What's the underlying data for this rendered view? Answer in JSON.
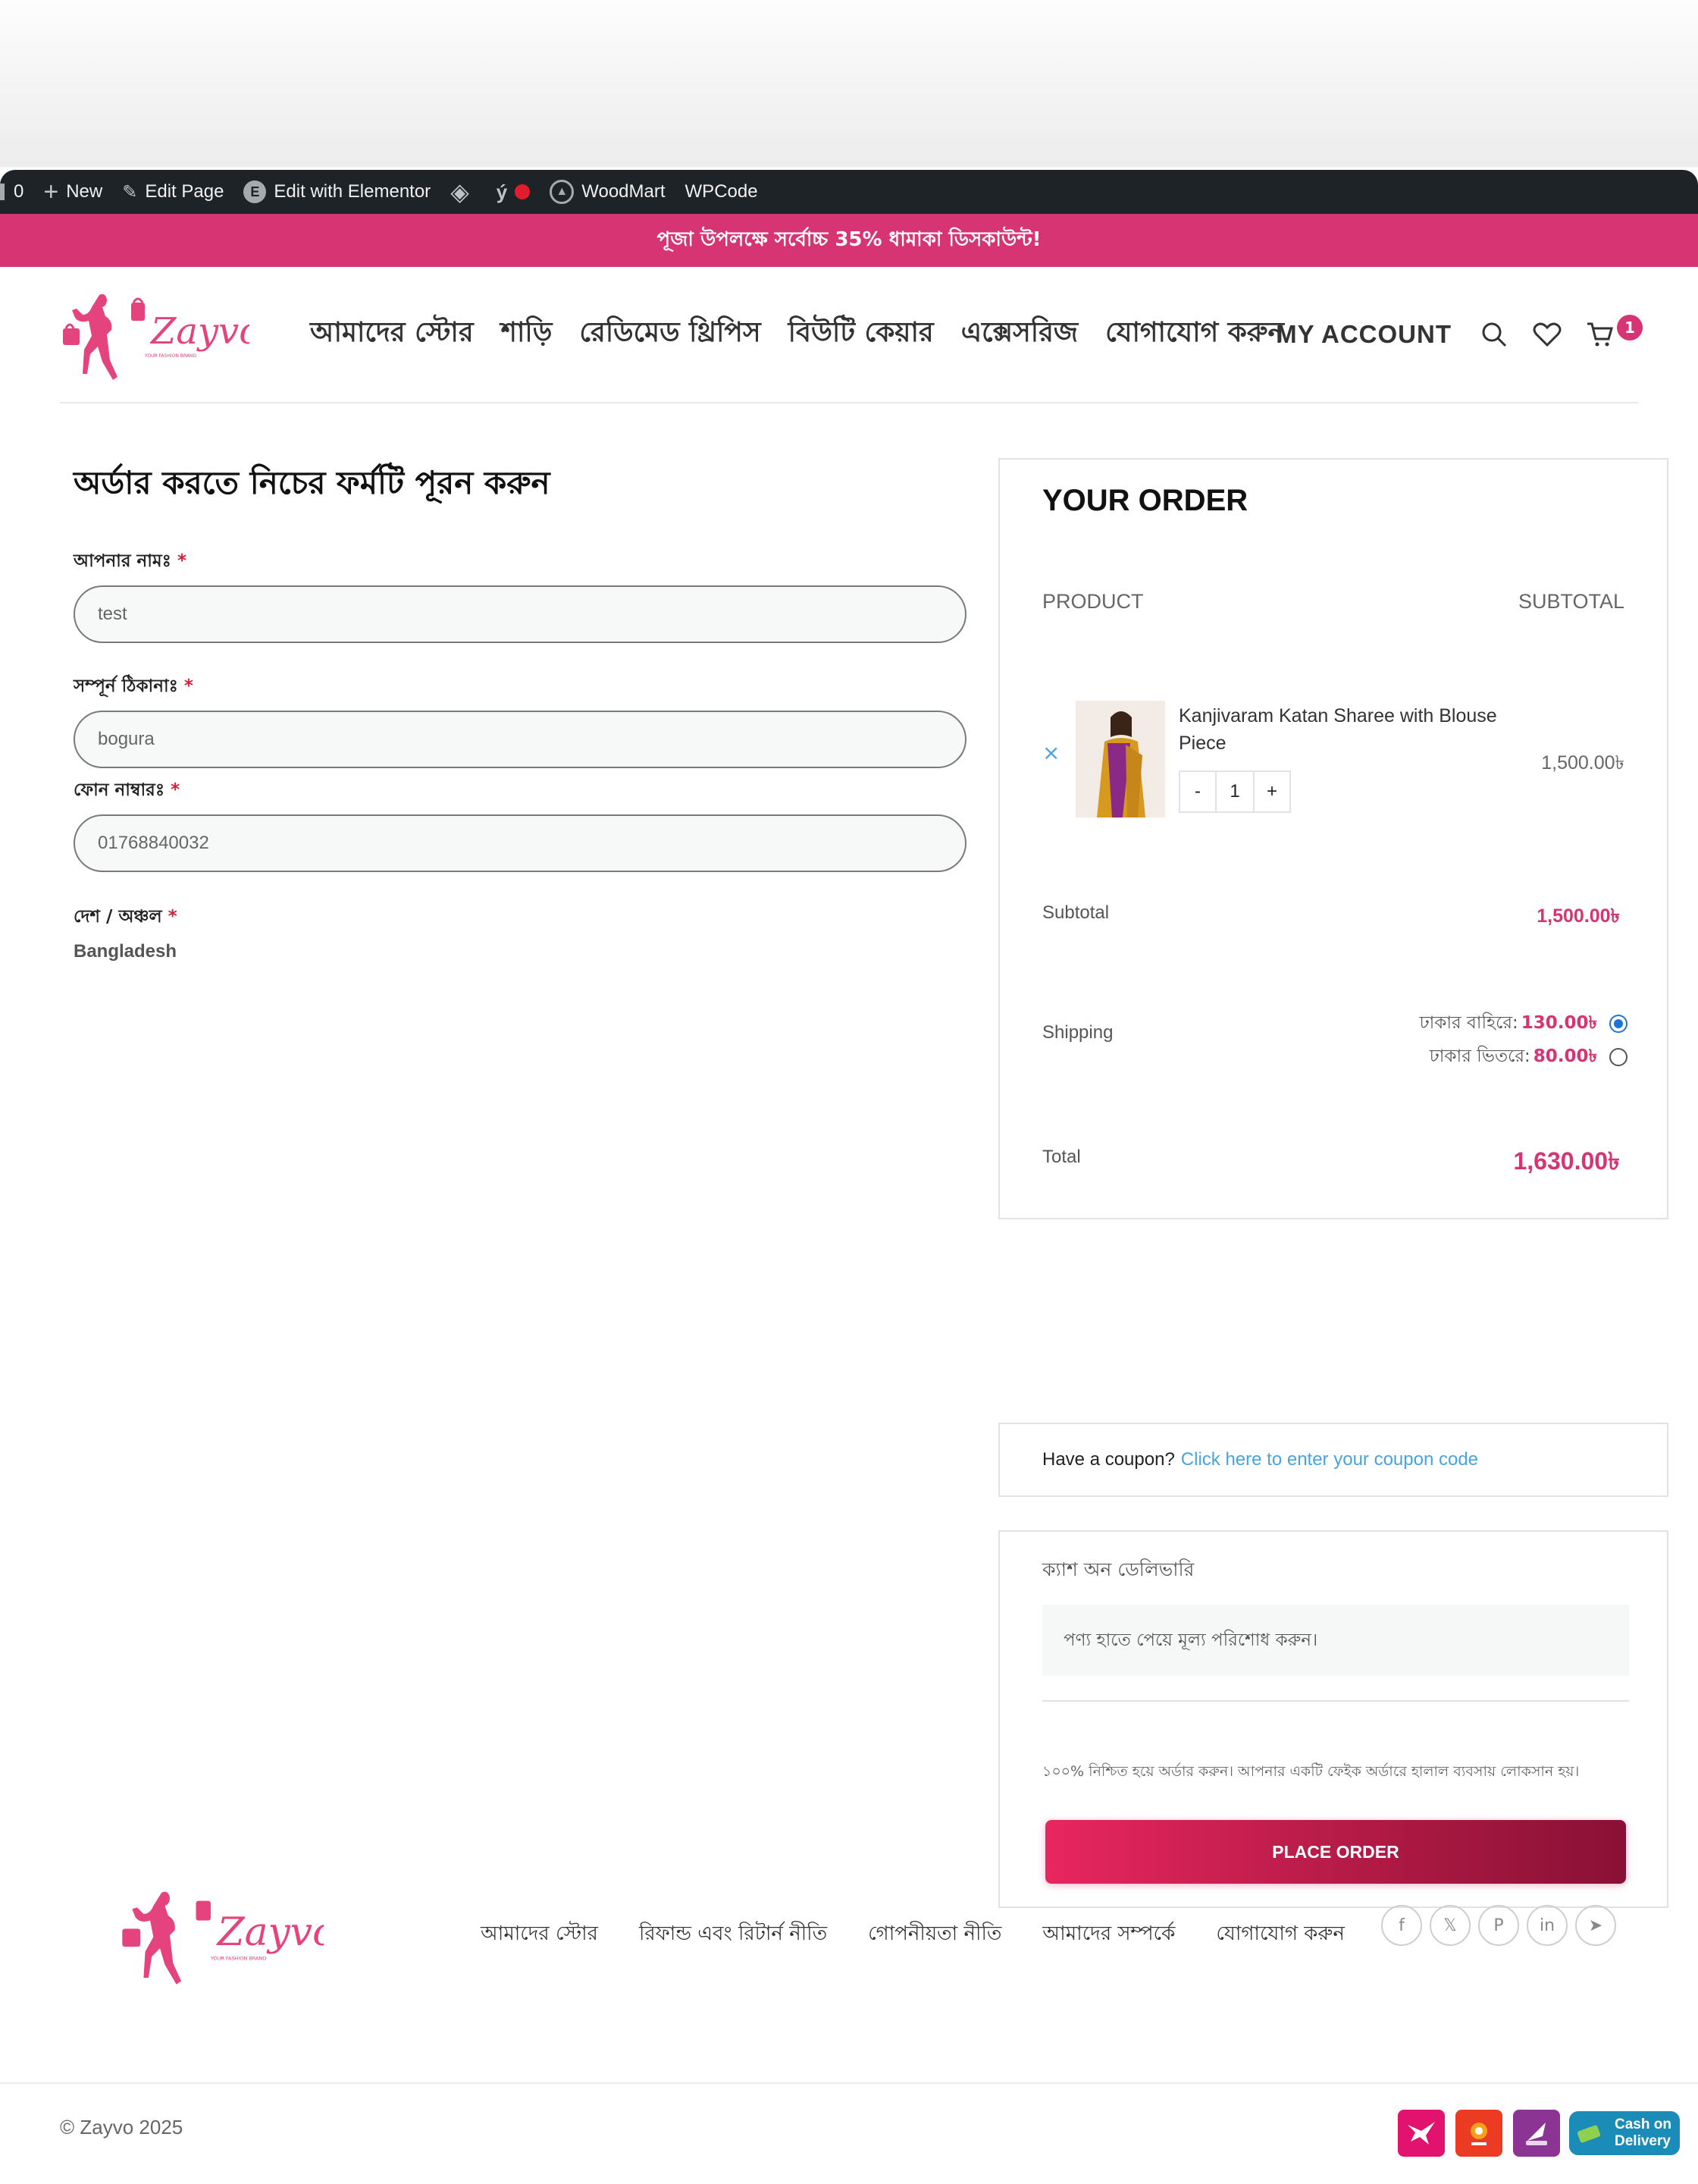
{
  "admin_bar": {
    "count": "0",
    "new_label": "New",
    "edit_page_label": "Edit Page",
    "elementor_label": "Edit with Elementor",
    "woodmart_label": "WoodMart",
    "wpcode_label": "WPCode"
  },
  "promo": {
    "text": "পূজা উপলক্ষে সর্বোচ্চ 35% ধামাকা ডিসকাউন্ট!"
  },
  "header": {
    "logo_text": "Zayvo",
    "logo_tagline": "YOUR FASHION BRAND",
    "nav": [
      "আমাদের স্টোর",
      "শাড়ি",
      "রেডিমেড থ্রিপিস",
      "বিউটি কেয়ার",
      "এক্সেসরিজ",
      "যোগাযোগ করুন"
    ],
    "account_label": "MY ACCOUNT",
    "cart_count": "1"
  },
  "form": {
    "title": "অর্ডার করতে নিচের ফর্মটি পূরন করুন",
    "name_label": "আপনার নামঃ",
    "name_value": "test",
    "address_label": "সম্পূর্ন ঠিকানাঃ",
    "address_value": "bogura",
    "phone_label": "ফোন নাম্বারঃ",
    "phone_value": "01768840032",
    "country_label": "দেশ / অঞ্চল",
    "country_value": "Bangladesh",
    "required_mark": "*"
  },
  "order": {
    "title": "YOUR ORDER",
    "col_product": "PRODUCT",
    "col_subtotal": "SUBTOTAL",
    "remove_symbol": "×",
    "product_name": "Kanjivaram Katan Sharee with Blouse Piece",
    "qty_minus": "-",
    "qty_value": "1",
    "qty_plus": "+",
    "product_price": "1,500.00৳",
    "subtotal_label": "Subtotal",
    "subtotal_value": "1,500.00৳",
    "shipping_label": "Shipping",
    "ship_outside_label": "ঢাকার বাহিরে:",
    "ship_outside_price": "130.00৳",
    "ship_inside_label": "ঢাকার ভিতরে:",
    "ship_inside_price": "80.00৳",
    "total_label": "Total",
    "total_value": "1,630.00৳"
  },
  "coupon": {
    "prompt": "Have a coupon?",
    "link": "Click here to enter your coupon code"
  },
  "payment": {
    "method": "ক্যাশ অন ডেলিভারি",
    "description": "পণ্য হাতে পেয়ে মূল্য পরিশোধ করুন।",
    "note": "১০০% নিশ্চিত হয়ে অর্ডার করুন। আপনার একটি ফেইক অর্ডারে হালাল ব্যবসায় লোকসান হয়।",
    "place_order": "PLACE ORDER"
  },
  "footer": {
    "nav": [
      "আমাদের স্টোর",
      "রিফান্ড এবং রিটার্ন নীতি",
      "গোপনীয়তা নীতি",
      "আমাদের সম্পর্কে",
      "যোগাযোগ করুন"
    ],
    "copyright": "© Zayvo 2025",
    "social": [
      "f",
      "𝕏",
      "P",
      "in",
      "➤"
    ],
    "cod_badge": "Cash on Delivery",
    "cod_line1": "Cash on",
    "cod_line2": "Delivery"
  },
  "colors": {
    "brand_pink": "#d63473",
    "admin_bar": "#1d2327",
    "link_blue": "#4aa3df"
  }
}
